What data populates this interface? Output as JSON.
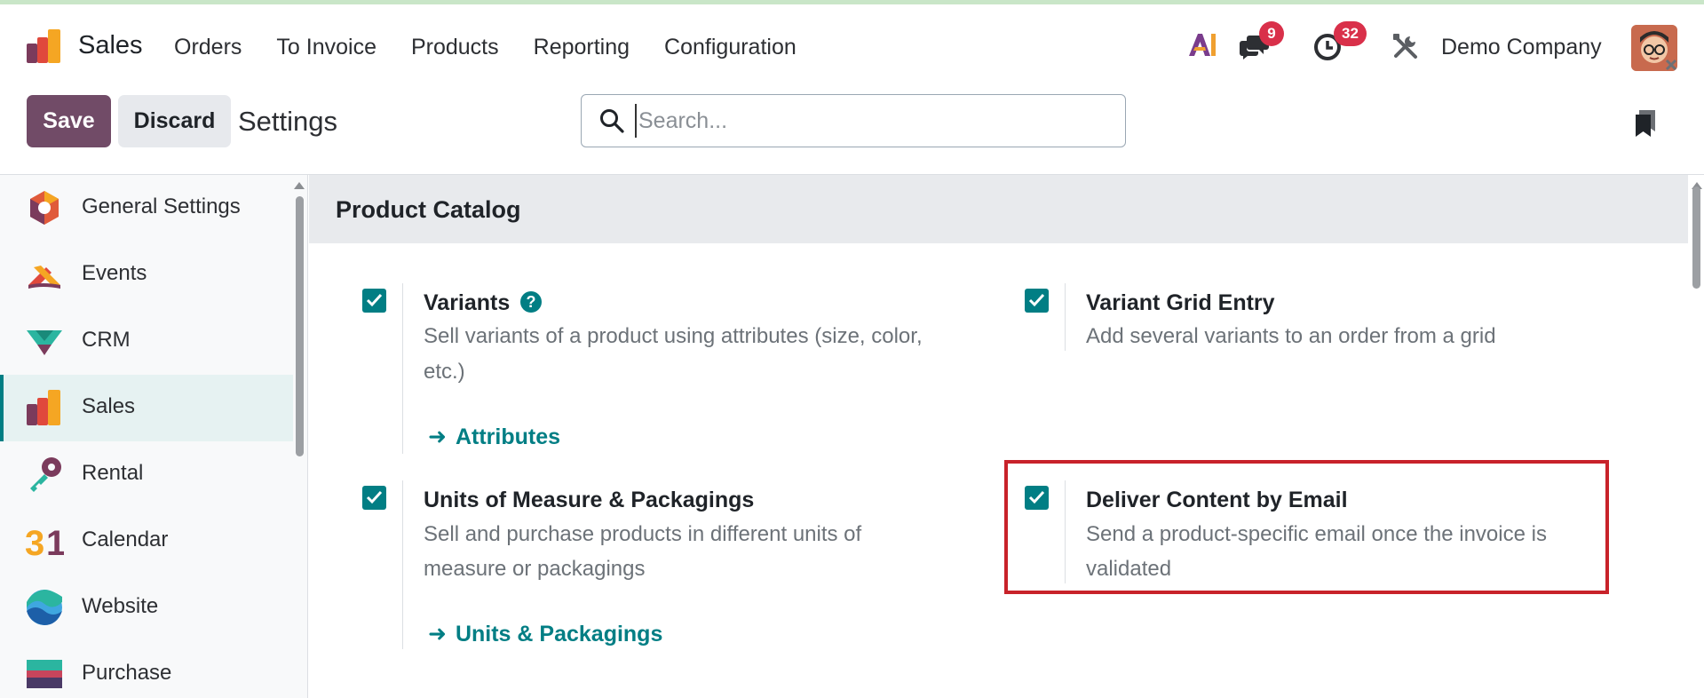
{
  "navbar": {
    "app_name": "Sales",
    "menu": [
      "Orders",
      "To Invoice",
      "Products",
      "Reporting",
      "Configuration"
    ],
    "ai_icon": "ai-icon",
    "messages_count": "9",
    "activities_count": "32",
    "company": "Demo Company"
  },
  "control_panel": {
    "save_label": "Save",
    "discard_label": "Discard",
    "title": "Settings",
    "search_placeholder": "Search..."
  },
  "sidebar": {
    "items": [
      {
        "label": "General Settings",
        "icon": "general-settings-icon",
        "active": false
      },
      {
        "label": "Events",
        "icon": "events-icon",
        "active": false
      },
      {
        "label": "CRM",
        "icon": "crm-icon",
        "active": false
      },
      {
        "label": "Sales",
        "icon": "sales-icon",
        "active": true
      },
      {
        "label": "Rental",
        "icon": "rental-icon",
        "active": false
      },
      {
        "label": "Calendar",
        "icon": "calendar-icon",
        "active": false
      },
      {
        "label": "Website",
        "icon": "website-icon",
        "active": false
      },
      {
        "label": "Purchase",
        "icon": "purchase-icon",
        "active": false
      }
    ]
  },
  "section": {
    "title": "Product Catalog",
    "settings": {
      "variants": {
        "title": "Variants",
        "desc_line1": "Sell variants of a product using attributes (size, color,",
        "desc_line2": "etc.)",
        "link": "Attributes",
        "checked": true
      },
      "variant_grid": {
        "title": "Variant Grid Entry",
        "desc_line1": "Add several variants to an order from a grid",
        "checked": true
      },
      "uom": {
        "title": "Units of Measure & Packagings",
        "desc_line1": "Sell and purchase products in different units of",
        "desc_line2": "measure or packagings",
        "link": "Units & Packagings",
        "checked": true
      },
      "deliver_email": {
        "title": "Deliver Content by Email",
        "desc_line1": "Send a product-specific email once the invoice is",
        "desc_line2": "validated",
        "checked": true
      }
    }
  },
  "colors": {
    "brand": "#714b67",
    "accent": "#017e84",
    "highlight": "#c8222a",
    "badge": "#d9304a"
  }
}
